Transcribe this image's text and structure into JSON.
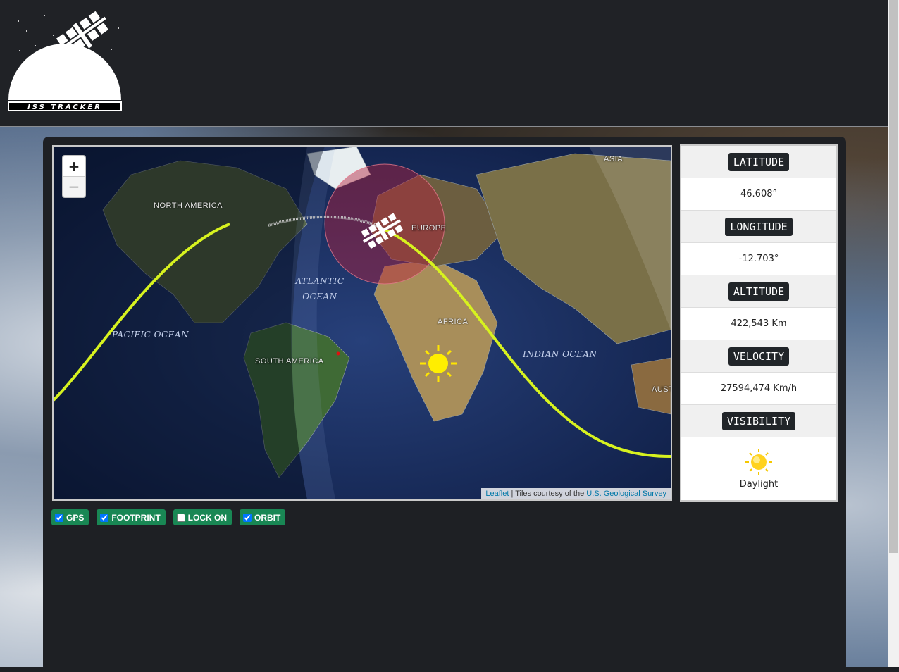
{
  "header": {
    "logo_text": "ISS TRACKER"
  },
  "map": {
    "zoom_in": "+",
    "zoom_out": "−",
    "labels": {
      "north_america": "NORTH AMERICA",
      "europe": "EUROPE",
      "asia": "ASIA",
      "africa": "AFRICA",
      "south_america": "SOUTH AMERICA",
      "australia": "AUST",
      "atlantic_1": "ATLANTIC",
      "atlantic_2": "OCEAN",
      "pacific": "PACIFIC OCEAN",
      "indian": "INDIAN OCEAN"
    },
    "attribution": {
      "leaflet": "Leaflet",
      "separator": " | Tiles courtesy of the ",
      "usgs": "U.S. Geological Survey"
    }
  },
  "info": {
    "latitude_label": "LATITUDE",
    "latitude_value": "46.608°",
    "longitude_label": "LONGITUDE",
    "longitude_value": "-12.703°",
    "altitude_label": "ALTITUDE",
    "altitude_value": "422,543 Km",
    "velocity_label": "VELOCITY",
    "velocity_value": "27594,474 Km/h",
    "visibility_label": "VISIBILITY",
    "visibility_value": "Daylight",
    "visibility_icon": "sun-icon"
  },
  "controls": [
    {
      "label": "GPS",
      "checked": true
    },
    {
      "label": "FOOTPRINT",
      "checked": true
    },
    {
      "label": "LOCK ON",
      "checked": false
    },
    {
      "label": "ORBIT",
      "checked": true
    }
  ],
  "colors": {
    "accent_green": "#198754",
    "orbit_yellow": "#d7f21f",
    "footprint": "#b3223f"
  }
}
